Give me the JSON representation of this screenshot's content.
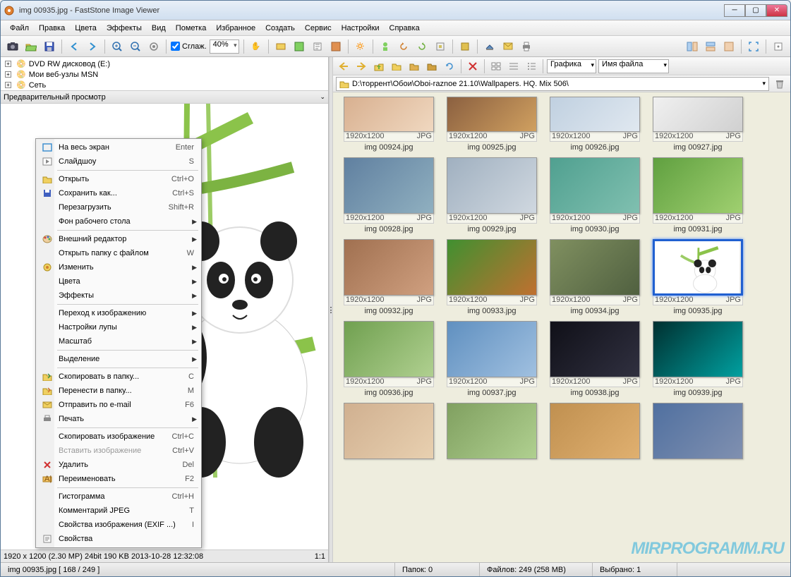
{
  "title": "img 00935.jpg  -  FastStone Image Viewer",
  "menus": [
    "Файл",
    "Правка",
    "Цвета",
    "Эффекты",
    "Вид",
    "Пометка",
    "Избранное",
    "Создать",
    "Сервис",
    "Настройки",
    "Справка"
  ],
  "smooth_label": "Сглаж.",
  "zoom_value": "40%",
  "tree": {
    "items": [
      {
        "icon": "disc",
        "label": "DVD RW дисковод (E:)",
        "expand": "+"
      },
      {
        "icon": "msn",
        "label": "Мои веб-узлы MSN",
        "expand": "+"
      },
      {
        "icon": "net",
        "label": "Сеть",
        "expand": "+"
      }
    ]
  },
  "preview_header": "Предварительный просмотр",
  "preview_status_left": "1920 x 1200 (2.30 MP)  24bit  190 KB  2013-10-28 12:32:08",
  "preview_status_right": "1:1 ",
  "nav": {
    "view_mode": "Графика",
    "sort_by": "Имя файла"
  },
  "path": "D:\\торрент\\Обои\\Oboi-raznoe 21.10\\Wallpapers. HQ. Mix 506\\",
  "thumbnails": [
    {
      "name": "img 00924.jpg",
      "dim": "1920x1200",
      "fmt": "JPG",
      "c1": "#d8b090",
      "c2": "#f0d8c0",
      "half": true
    },
    {
      "name": "img 00925.jpg",
      "dim": "1920x1200",
      "fmt": "JPG",
      "c1": "#8b6040",
      "c2": "#d0a060",
      "half": true
    },
    {
      "name": "img 00926.jpg",
      "dim": "1920x1200",
      "fmt": "JPG",
      "c1": "#c0d0e0",
      "c2": "#e0e8f0",
      "half": true
    },
    {
      "name": "img 00927.jpg",
      "dim": "1920x1200",
      "fmt": "JPG",
      "c1": "#f0f0f0",
      "c2": "#d0d0d0",
      "half": true
    },
    {
      "name": "img 00928.jpg",
      "dim": "1920x1200",
      "fmt": "JPG",
      "c1": "#6080a0",
      "c2": "#90b0c0"
    },
    {
      "name": "img 00929.jpg",
      "dim": "1920x1200",
      "fmt": "JPG",
      "c1": "#a0b0c0",
      "c2": "#d0d8e0"
    },
    {
      "name": "img 00930.jpg",
      "dim": "1920x1200",
      "fmt": "JPG",
      "c1": "#50a090",
      "c2": "#80c0b0"
    },
    {
      "name": "img 00931.jpg",
      "dim": "1920x1200",
      "fmt": "JPG",
      "c1": "#60a040",
      "c2": "#a0d070"
    },
    {
      "name": "img 00932.jpg",
      "dim": "1920x1200",
      "fmt": "JPG",
      "c1": "#a07050",
      "c2": "#d0a080"
    },
    {
      "name": "img 00933.jpg",
      "dim": "1920x1200",
      "fmt": "JPG",
      "c1": "#409030",
      "c2": "#c07030"
    },
    {
      "name": "img 00934.jpg",
      "dim": "1920x1200",
      "fmt": "JPG",
      "c1": "#809060",
      "c2": "#506040"
    },
    {
      "name": "img 00935.jpg",
      "dim": "1920x1200",
      "fmt": "JPG",
      "c1": "#ffffff",
      "c2": "#e0e0e0",
      "selected": true
    },
    {
      "name": "img 00936.jpg",
      "dim": "1920x1200",
      "fmt": "JPG",
      "c1": "#70a050",
      "c2": "#b0d090"
    },
    {
      "name": "img 00937.jpg",
      "dim": "1920x1200",
      "fmt": "JPG",
      "c1": "#6090c0",
      "c2": "#a0c0e0"
    },
    {
      "name": "img 00938.jpg",
      "dim": "1920x1200",
      "fmt": "JPG",
      "c1": "#101018",
      "c2": "#303040"
    },
    {
      "name": "img 00939.jpg",
      "dim": "1920x1200",
      "fmt": "JPG",
      "c1": "#003030",
      "c2": "#00a0a0"
    },
    {
      "name": "",
      "dim": "",
      "fmt": "",
      "c1": "#d0b090",
      "c2": "#e8d0b0",
      "partial": true
    },
    {
      "name": "",
      "dim": "",
      "fmt": "",
      "c1": "#80a060",
      "c2": "#b0d090",
      "partial": true
    },
    {
      "name": "",
      "dim": "",
      "fmt": "",
      "c1": "#c09050",
      "c2": "#e0b070",
      "partial": true
    },
    {
      "name": "",
      "dim": "",
      "fmt": "",
      "c1": "#5070a0",
      "c2": "#8090b0",
      "partial": true
    }
  ],
  "status": {
    "file": "img 00935.jpg  [ 168 / 249 ]",
    "folders": "Папок: 0",
    "files": "Файлов: 249 (258 MB)",
    "selected": "Выбрано: 1"
  },
  "context_menu": [
    {
      "icon": "fullscreen",
      "label": "На весь экран",
      "shortcut": "Enter"
    },
    {
      "icon": "slideshow",
      "label": "Слайдшоу",
      "shortcut": "S"
    },
    {
      "sep": true
    },
    {
      "icon": "open",
      "label": "Открыть",
      "shortcut": "Ctrl+O"
    },
    {
      "icon": "save",
      "label": "Сохранить как...",
      "shortcut": "Ctrl+S"
    },
    {
      "label": "Перезагрузить",
      "shortcut": "Shift+R"
    },
    {
      "label": "Фон рабочего стола",
      "sub": true
    },
    {
      "sep": true
    },
    {
      "icon": "palette",
      "label": "Внешний редактор",
      "sub": true
    },
    {
      "label": "Открыть папку с файлом",
      "shortcut": "W"
    },
    {
      "icon": "edit",
      "label": "Изменить",
      "sub": true
    },
    {
      "label": "Цвета",
      "sub": true
    },
    {
      "label": "Эффекты",
      "sub": true
    },
    {
      "sep": true
    },
    {
      "label": "Переход к изображению",
      "sub": true
    },
    {
      "label": "Настройки лупы",
      "sub": true
    },
    {
      "label": "Масштаб",
      "sub": true
    },
    {
      "sep": true
    },
    {
      "label": "Выделение",
      "sub": true
    },
    {
      "sep": true
    },
    {
      "icon": "copyto",
      "label": "Скопировать в папку...",
      "shortcut": "C"
    },
    {
      "icon": "moveto",
      "label": "Перенести в папку...",
      "shortcut": "M"
    },
    {
      "icon": "email",
      "label": "Отправить по e-mail",
      "shortcut": "F6"
    },
    {
      "icon": "print",
      "label": "Печать",
      "sub": true
    },
    {
      "sep": true
    },
    {
      "label": "Скопировать изображение",
      "shortcut": "Ctrl+C"
    },
    {
      "label": "Вставить изображение",
      "shortcut": "Ctrl+V",
      "disabled": true
    },
    {
      "icon": "delete",
      "label": "Удалить",
      "shortcut": "Del"
    },
    {
      "icon": "rename",
      "label": "Переименовать",
      "shortcut": "F2"
    },
    {
      "sep": true
    },
    {
      "label": "Гистограмма",
      "shortcut": "Ctrl+H"
    },
    {
      "label": "Комментарий JPEG",
      "shortcut": "T"
    },
    {
      "label": "Свойства изображения (EXIF ...)",
      "shortcut": "I"
    },
    {
      "icon": "props",
      "label": "Свойства"
    }
  ],
  "watermark": "MIRPROGRAMM.RU"
}
